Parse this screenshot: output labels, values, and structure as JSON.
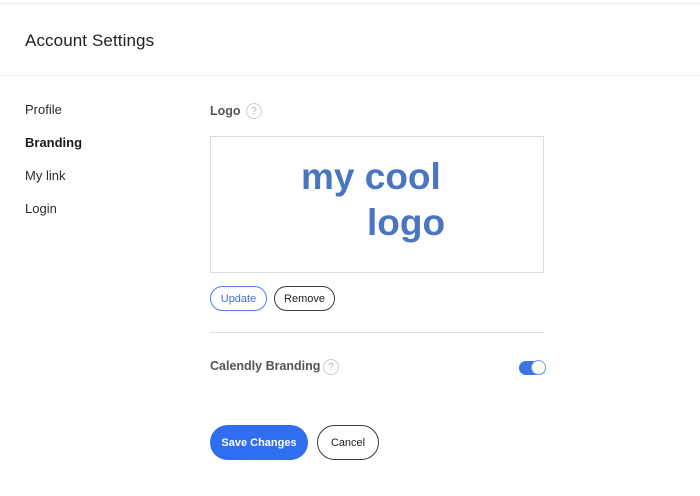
{
  "header": {
    "title": "Account Settings"
  },
  "sidebar": {
    "items": [
      {
        "label": "Profile",
        "active": false
      },
      {
        "label": "Branding",
        "active": true
      },
      {
        "label": "My link",
        "active": false
      },
      {
        "label": "Login",
        "active": false
      }
    ]
  },
  "logo_section": {
    "label": "Logo",
    "help_glyph": "?",
    "logo_text_line1": "my cool",
    "logo_text_line2": "logo",
    "update_label": "Update",
    "remove_label": "Remove"
  },
  "branding_section": {
    "label": "Calendly Branding",
    "help_glyph": "?",
    "toggle_on": true
  },
  "actions": {
    "save_label": "Save Changes",
    "cancel_label": "Cancel"
  },
  "colors": {
    "accent": "#2f6ef0",
    "logo_text": "#4a76c0"
  }
}
